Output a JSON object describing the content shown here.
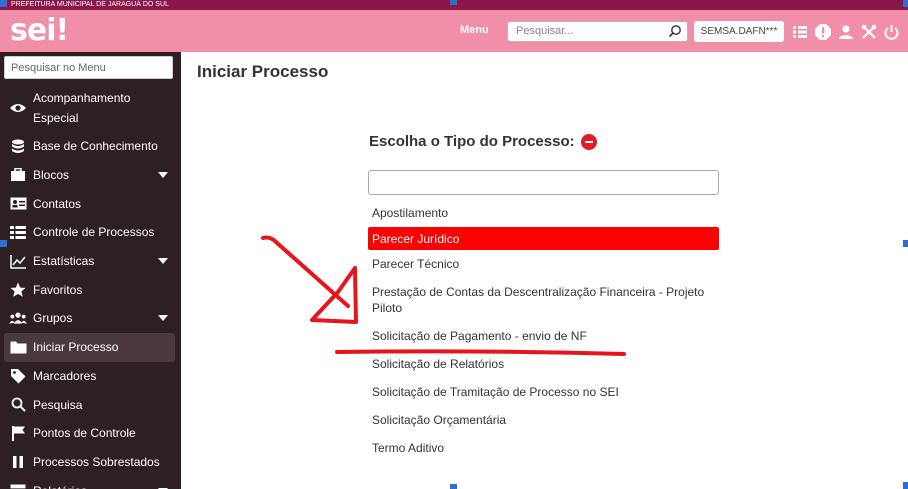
{
  "org_name": "PREFEITURA MUNICIPAL DE JARAGUÁ DO SUL",
  "header": {
    "logo": "sei!",
    "menu_label": "Menu",
    "search_placeholder": "Pesquisar...",
    "unit": "SEMSA.DAFN***",
    "icons": [
      "list-icon",
      "alert-icon",
      "user-icon",
      "tools-icon",
      "power-icon"
    ]
  },
  "sidebar": {
    "search_placeholder": "Pesquisar no Menu",
    "items": [
      {
        "label": "Acompanhamento Especial",
        "icon": "eye-icon",
        "caret": false
      },
      {
        "label": "Base de Conhecimento",
        "icon": "database-icon",
        "caret": false
      },
      {
        "label": "Blocos",
        "icon": "briefcase-icon",
        "caret": true
      },
      {
        "label": "Contatos",
        "icon": "contact-card-icon",
        "caret": false
      },
      {
        "label": "Controle de Processos",
        "icon": "list-icon",
        "caret": false
      },
      {
        "label": "Estatísticas",
        "icon": "line-chart-icon",
        "caret": true
      },
      {
        "label": "Favoritos",
        "icon": "star-icon",
        "caret": false
      },
      {
        "label": "Grupos",
        "icon": "group-icon",
        "caret": true
      },
      {
        "label": "Iniciar Processo",
        "icon": "folder-icon",
        "caret": false,
        "active": true
      },
      {
        "label": "Marcadores",
        "icon": "tag-icon",
        "caret": false
      },
      {
        "label": "Pesquisa",
        "icon": "search-icon",
        "caret": false
      },
      {
        "label": "Pontos de Controle",
        "icon": "flag-icon",
        "caret": false
      },
      {
        "label": "Processos Sobrestados",
        "icon": "pause-icon",
        "caret": false
      },
      {
        "label": "Relatórios",
        "icon": "table-icon",
        "caret": true
      }
    ]
  },
  "main": {
    "title": "Iniciar Processo",
    "choose_label": "Escolha o Tipo do Processo:",
    "filter_value": "",
    "types": [
      "Apostilamento",
      "Parecer Jurídico",
      "Parecer Técnico",
      "Prestação de Contas da Descentralização Financeira - Projeto Piloto",
      "Solicitação de Pagamento - envio de NF",
      "Solicitação de Relatórios",
      "Solicitação de Tramitação de Processo no SEI",
      "Solicitação Orçamentária",
      "Termo Aditivo"
    ],
    "selected_index": 1
  },
  "colors": {
    "org_bar": "#8a1846",
    "header": "#f28fa8",
    "sidebar": "#2e1f22",
    "selected": "#ff0000",
    "annotation": "#e8141c"
  }
}
